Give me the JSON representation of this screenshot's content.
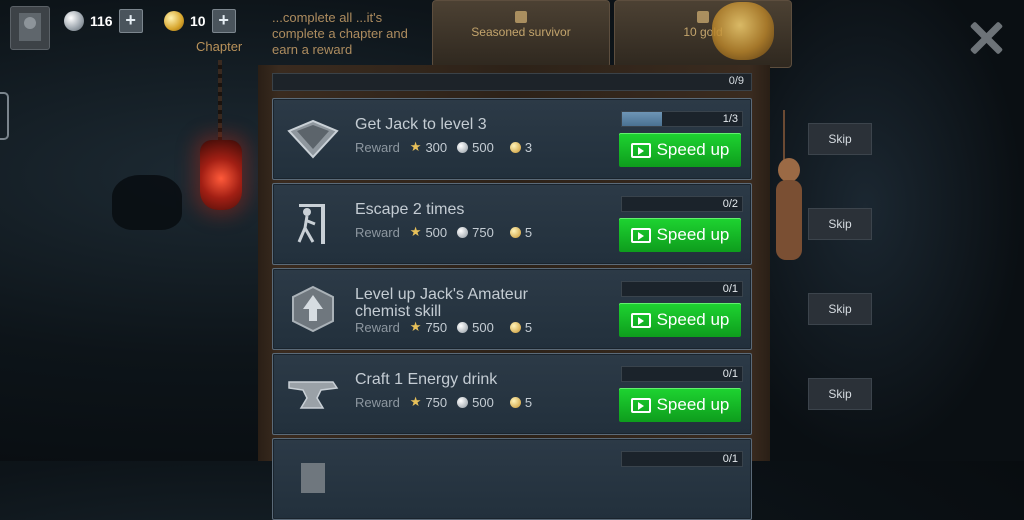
{
  "top_bar": {
    "silver": "116",
    "gold": "10",
    "plus": "+",
    "chapter_label": "Chapter",
    "info_text": "...complete all ...it's complete a chapter and earn a reward",
    "reward_box_1": "Seasoned survivor",
    "reward_box_2": "10 gold"
  },
  "overall_progress": "0/9",
  "speed_up_label": "Speed up",
  "skip_label": "Skip",
  "reward_label": "Reward",
  "tasks": [
    {
      "title": "Get Jack to level 3",
      "icon": "diamond-icon",
      "xp": "300",
      "silver": "500",
      "gold": "3",
      "progress_text": "1/3",
      "progress": 0.333
    },
    {
      "title": "Escape 2 times",
      "icon": "escape-door-icon",
      "xp": "500",
      "silver": "750",
      "gold": "5",
      "progress_text": "0/2",
      "progress": 0
    },
    {
      "title": "Level up Jack's Amateur chemist skill",
      "icon": "level-up-icon",
      "xp": "750",
      "silver": "500",
      "gold": "5",
      "progress_text": "0/1",
      "progress": 0
    },
    {
      "title": "Craft 1 Energy drink",
      "icon": "anvil-icon",
      "xp": "750",
      "silver": "500",
      "gold": "5",
      "progress_text": "0/1",
      "progress": 0
    },
    {
      "title": "",
      "icon": "task-icon",
      "xp": "",
      "silver": "",
      "gold": "",
      "progress_text": "0/1",
      "progress": 0
    }
  ],
  "colors": {
    "speed_up": "#14b824",
    "panel": "#2c3a47",
    "accent_gold": "#c3a46c"
  }
}
